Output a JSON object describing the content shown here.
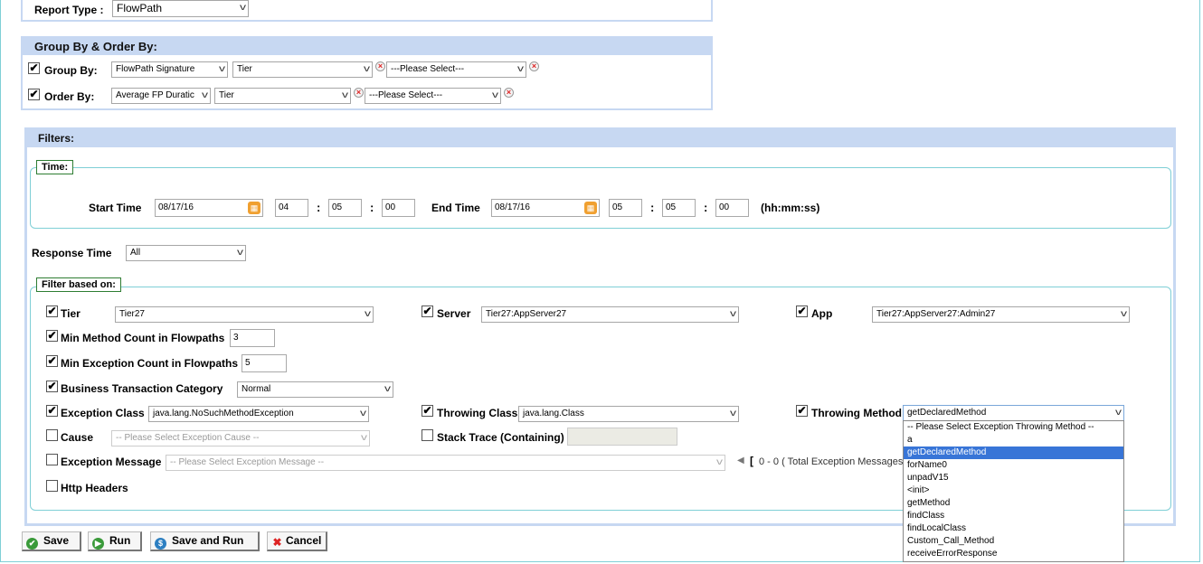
{
  "report": {
    "label": "Report Type :",
    "value": "FlowPath"
  },
  "group_order": {
    "title": "Group By & Order By:",
    "group_by": {
      "label": "Group By:",
      "sel1": "FlowPath Signature",
      "sel2": "Tier",
      "sel3": "---Please Select---"
    },
    "order_by": {
      "label": "Order By:",
      "sel1": "Average FP Duratic",
      "sel2": "Tier",
      "sel3": "---Please Select---"
    }
  },
  "filters": {
    "title": "Filters:",
    "time": {
      "legend": "Time:",
      "start_label": "Start Time",
      "start_date": "08/17/16",
      "start_hh": "04",
      "start_mm": "05",
      "start_ss": "00",
      "end_label": "End Time",
      "end_date": "08/17/16",
      "end_hh": "05",
      "end_mm": "05",
      "end_ss": "00",
      "format": "(hh:mm:ss)",
      "colon": ":"
    },
    "response_time": {
      "label": "Response Time",
      "value": "All"
    },
    "based_on": {
      "legend": "Filter based on:",
      "tier": {
        "label": "Tier",
        "value": "Tier27"
      },
      "server": {
        "label": "Server",
        "value": "Tier27:AppServer27"
      },
      "app": {
        "label": "App",
        "value": "Tier27:AppServer27:Admin27"
      },
      "min_method": {
        "label": "Min Method Count in Flowpaths",
        "value": "3"
      },
      "min_exception": {
        "label": "Min Exception Count in Flowpaths",
        "value": "5"
      },
      "btc": {
        "label": "Business Transaction Category",
        "value": "Normal"
      },
      "exception_class": {
        "label": "Exception Class",
        "value": "java.lang.NoSuchMethodException"
      },
      "throwing_class": {
        "label": "Throwing Class",
        "value": "java.lang.Class"
      },
      "throwing_method": {
        "label": "Throwing Method",
        "value": "getDeclaredMethod",
        "options": [
          "-- Please Select Exception Throwing Method --",
          "a",
          "getDeclaredMethod",
          "forName0",
          "unpadV15",
          "<init>",
          "getMethod",
          "findClass",
          "findLocalClass",
          "Custom_Call_Method",
          "receiveErrorResponse"
        ],
        "selected_index": 2
      },
      "cause": {
        "label": "Cause",
        "placeholder": "-- Please Select Exception Cause --"
      },
      "stack_trace": {
        "label": "Stack Trace (Containing)"
      },
      "exception_message": {
        "label": "Exception Message",
        "placeholder": "-- Please Select Exception Message --",
        "paging": "0 - 0 ( Total Exception Messages"
      },
      "http_headers": {
        "label": "Http Headers"
      }
    }
  },
  "buttons": {
    "save": "Save",
    "run": "Run",
    "save_run": "Save and Run",
    "cancel": "Cancel"
  },
  "colors": {
    "header_bg": "#c7d8f2",
    "fieldset_border": "#7fcfd6",
    "legend_border": "#2e7d32",
    "highlight": "#3875d7"
  },
  "icons": {
    "check": "✔",
    "close": "×",
    "calendar": "calendar-icon",
    "arrow": "▾"
  }
}
